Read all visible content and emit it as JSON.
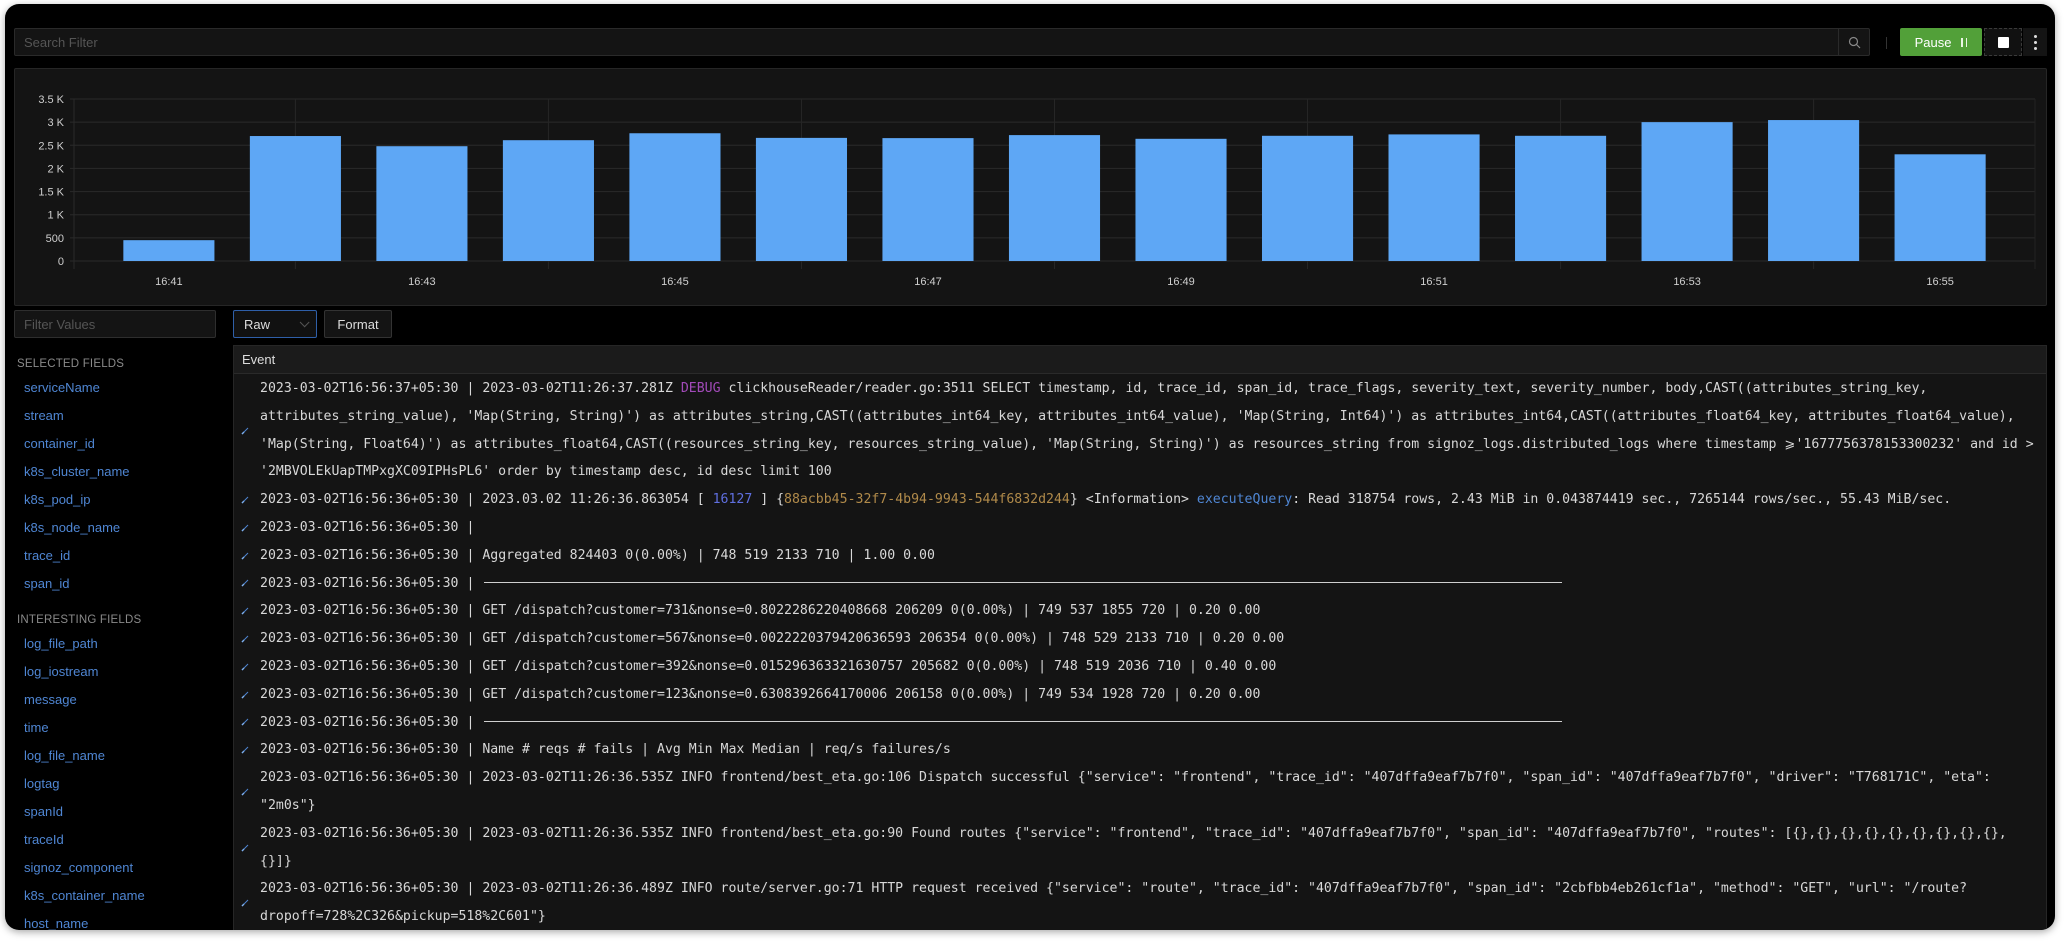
{
  "search": {
    "placeholder": "Search Filter",
    "search_icon": "search-icon"
  },
  "toolbar": {
    "pause_label": "Pause",
    "pause_icon": "pause-icon",
    "stop_icon": "stop-icon",
    "more_icon": "more-vertical-icon"
  },
  "colors": {
    "accent": "#52a039",
    "bar": "#5ea7f5",
    "link": "#4f86d3",
    "debug": "#a14ab8",
    "background": "#000000",
    "panel": "#141414"
  },
  "chart_data": {
    "type": "bar",
    "title": "",
    "xlabel": "",
    "ylabel": "",
    "categories": [
      "16:41",
      "16:42",
      "16:43",
      "16:44",
      "16:45",
      "16:46",
      "16:47",
      "16:48",
      "16:49",
      "16:50",
      "16:51",
      "16:52",
      "16:53",
      "16:54",
      "16:55"
    ],
    "values": [
      450,
      2700,
      2480,
      2610,
      2760,
      2660,
      2655,
      2720,
      2640,
      2705,
      2735,
      2705,
      3000,
      3045,
      2305
    ],
    "x_tick_labels": [
      "16:41",
      "16:43",
      "16:45",
      "16:47",
      "16:49",
      "16:51",
      "16:53",
      "16:55"
    ],
    "y_tick_labels": [
      "0",
      "500",
      "1 K",
      "1.5 K",
      "2 K",
      "2.5 K",
      "3 K",
      "3.5 K"
    ],
    "y_ticks": [
      0,
      500,
      1000,
      1500,
      2000,
      2500,
      3000,
      3500
    ],
    "ylim": [
      0,
      3500
    ],
    "grid": true,
    "legend": "none"
  },
  "sidebar": {
    "filter_placeholder": "Filter Values",
    "selected_heading": "SELECTED FIELDS",
    "selected_fields": [
      "serviceName",
      "stream",
      "container_id",
      "k8s_cluster_name",
      "k8s_pod_ip",
      "k8s_node_name",
      "trace_id",
      "span_id"
    ],
    "interesting_heading": "INTERESTING FIELDS",
    "interesting_fields": [
      "log_file_path",
      "log_iostream",
      "message",
      "time",
      "log_file_name",
      "logtag",
      "spanId",
      "traceId",
      "signoz_component",
      "k8s_container_name",
      "host_name"
    ]
  },
  "view": {
    "mode_selected": "Raw",
    "format_label": "Format"
  },
  "logs": {
    "column_header": "Event",
    "rows": [
      {
        "ts": "2023-03-02T16:56:37+05:30",
        "parts": [
          {
            "t": "2023-03-02T11:26:37.281Z "
          },
          {
            "t": "DEBUG",
            "c": "debug"
          },
          {
            "t": " clickhouseReader/reader.go:3511 SELECT timestamp, id, trace_id, span_id, trace_flags, severity_text, severity_number, body,CAST((attributes_string_key, attributes_string_value), 'Map(String, String)') as attributes_string,CAST((attributes_int64_key, attributes_int64_value), 'Map(String, Int64)') as attributes_int64,CAST((attributes_float64_key, attributes_float64_value), 'Map(String, Float64)') as attributes_float64,CAST((resources_string_key, resources_string_value), 'Map(String, String)') as resources_string from signoz_logs.distributed_logs where timestamp ⩾'1677756378153300232' and id > '2MBVOLEkUapTMPxgXC09IPHsPL6' order by timestamp desc, id desc limit 100"
          }
        ]
      },
      {
        "ts": "2023-03-02T16:56:36+05:30",
        "parts": [
          {
            "t": "2023.03.02 11:26:36.863054 [ "
          },
          {
            "t": "16127",
            "c": "pid"
          },
          {
            "t": " ] {"
          },
          {
            "t": "88acbb45-32f7-4b94-9943-544f6832d244",
            "c": "uuid"
          },
          {
            "t": "} <Information> "
          },
          {
            "t": "executeQuery",
            "c": "fn"
          },
          {
            "t": ": Read 318754 rows, 2.43 MiB in 0.043874419 sec., 7265144 rows/sec., 55.43 MiB/sec."
          }
        ]
      },
      {
        "ts": "2023-03-02T16:56:36+05:30",
        "parts": []
      },
      {
        "ts": "2023-03-02T16:56:36+05:30",
        "parts": [
          {
            "t": "Aggregated 824403 0(0.00%) | 748 519 2133 710 | 1.00 0.00"
          }
        ]
      },
      {
        "ts": "2023-03-02T16:56:36+05:30",
        "parts": [
          {
            "t": "",
            "c": "hr"
          }
        ]
      },
      {
        "ts": "2023-03-02T16:56:36+05:30",
        "parts": [
          {
            "t": "GET /dispatch?customer=731&nonse=0.8022286220408668 206209 0(0.00%) | 749 537 1855 720 | 0.20 0.00"
          }
        ]
      },
      {
        "ts": "2023-03-02T16:56:36+05:30",
        "parts": [
          {
            "t": "GET /dispatch?customer=567&nonse=0.0022220379420636593 206354 0(0.00%) | 748 529 2133 710 | 0.20 0.00"
          }
        ]
      },
      {
        "ts": "2023-03-02T16:56:36+05:30",
        "parts": [
          {
            "t": "GET /dispatch?customer=392&nonse=0.015296363321630757 205682 0(0.00%) | 748 519 2036 710 | 0.40 0.00"
          }
        ]
      },
      {
        "ts": "2023-03-02T16:56:36+05:30",
        "parts": [
          {
            "t": "GET /dispatch?customer=123&nonse=0.6308392664170006 206158 0(0.00%) | 749 534 1928 720 | 0.20 0.00"
          }
        ]
      },
      {
        "ts": "2023-03-02T16:56:36+05:30",
        "parts": [
          {
            "t": "",
            "c": "hr"
          }
        ]
      },
      {
        "ts": "2023-03-02T16:56:36+05:30",
        "parts": [
          {
            "t": "Name # reqs # fails | Avg Min Max Median | req/s failures/s"
          }
        ]
      },
      {
        "ts": "2023-03-02T16:56:36+05:30",
        "parts": [
          {
            "t": "2023-03-02T11:26:36.535Z INFO frontend/best_eta.go:106 Dispatch successful {\"service\": \"frontend\", \"trace_id\": \"407dffa9eaf7b7f0\", \"span_id\": \"407dffa9eaf7b7f0\", \"driver\": \"T768171C\", \"eta\": \"2m0s\"}"
          }
        ]
      },
      {
        "ts": "2023-03-02T16:56:36+05:30",
        "parts": [
          {
            "t": "2023-03-02T11:26:36.535Z INFO frontend/best_eta.go:90 Found routes {\"service\": \"frontend\", \"trace_id\": \"407dffa9eaf7b7f0\", \"span_id\": \"407dffa9eaf7b7f0\", \"routes\": [{},{},{},{},{},{},{},{},{},{}]}"
          }
        ]
      },
      {
        "ts": "2023-03-02T16:56:36+05:30",
        "parts": [
          {
            "t": "2023-03-02T11:26:36.489Z INFO route/server.go:71 HTTP request received {\"service\": \"route\", \"trace_id\": \"407dffa9eaf7b7f0\", \"span_id\": \"2cbfbb4eb261cf1a\", \"method\": \"GET\", \"url\": \"/route?dropoff=728%2C326&pickup=518%2C601\"}"
          }
        ]
      }
    ]
  }
}
